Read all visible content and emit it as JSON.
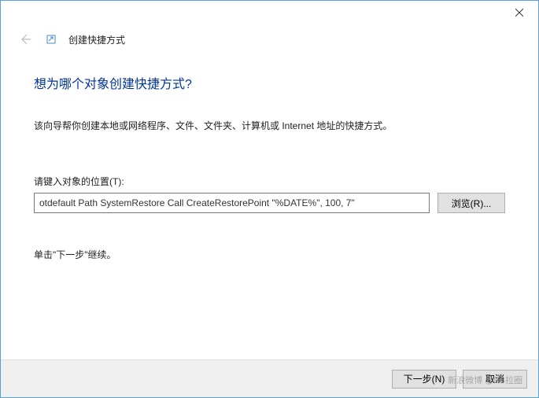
{
  "titlebar": {
    "close_tooltip": "关闭"
  },
  "header": {
    "wizard_label": "创建快捷方式"
  },
  "main": {
    "title": "想为哪个对象创建快捷方式?",
    "description": "该向导帮你创建本地或网络程序、文件、文件夹、计算机或 Internet 地址的快捷方式。",
    "input_label": "请键入对象的位置(T):",
    "location_value": "otdefault Path SystemRestore Call CreateRestorePoint \"%DATE%\", 100, 7\"",
    "browse_label": "浏览(R)...",
    "continue_text": "单击\"下一步\"继续。"
  },
  "footer": {
    "next_label": "下一步(N)",
    "cancel_label": "取消"
  },
  "watermark": "新浪微博 @BB拉圈"
}
